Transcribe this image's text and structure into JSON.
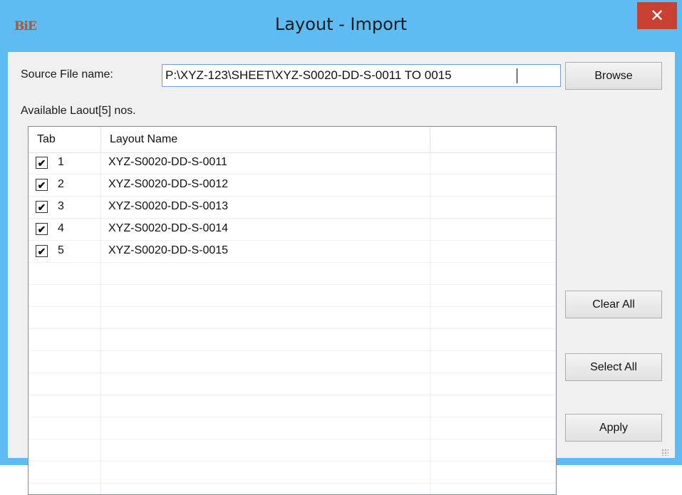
{
  "window": {
    "title": "Layout - Import",
    "app_icon_text": "BiE",
    "close_glyph": "✕",
    "colors": {
      "titlebar": "#5ebcf3",
      "close": "#c84133",
      "client": "#f0f0f0"
    }
  },
  "source": {
    "label": "Source File name:",
    "value": "P:\\XYZ-123\\SHEET\\XYZ-S0020-DD-S-0011 TO 0015"
  },
  "available_label": "Available Laout[5] nos.",
  "grid": {
    "columns": [
      "Tab",
      "Layout Name",
      ""
    ],
    "rows": [
      {
        "checked": true,
        "tab": "1",
        "name": "XYZ-S0020-DD-S-0011"
      },
      {
        "checked": true,
        "tab": "2",
        "name": "XYZ-S0020-DD-S-0012"
      },
      {
        "checked": true,
        "tab": "3",
        "name": "XYZ-S0020-DD-S-0013"
      },
      {
        "checked": true,
        "tab": "4",
        "name": "XYZ-S0020-DD-S-0014"
      },
      {
        "checked": true,
        "tab": "5",
        "name": "XYZ-S0020-DD-S-0015"
      }
    ],
    "check_glyph": "✔"
  },
  "buttons": {
    "browse": "Browse",
    "clear_all": "Clear All",
    "select_all": "Select All",
    "apply": "Apply"
  }
}
